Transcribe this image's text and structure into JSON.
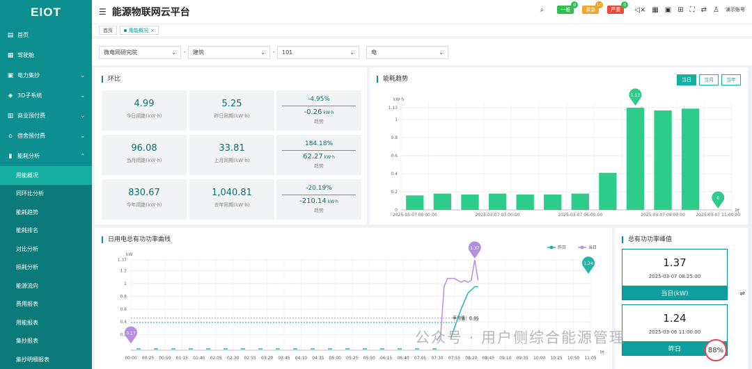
{
  "app": {
    "logo": "EIOT",
    "title": "能源物联网云平台"
  },
  "header": {
    "alarms": [
      {
        "label": "一般",
        "count": "0",
        "color": "#2fbf4f"
      },
      {
        "label": "紧急",
        "count": "10",
        "color": "#f5a623"
      },
      {
        "label": "严重",
        "count": "0",
        "color": "#e74c3c"
      }
    ],
    "account": "演示账号"
  },
  "sidebar": {
    "items": [
      {
        "label": "首页",
        "icon": "▤"
      },
      {
        "label": "驾驶舱",
        "icon": "▦"
      },
      {
        "label": "电力集抄",
        "icon": "▣",
        "chev": "⌄"
      },
      {
        "label": "3D子系统",
        "icon": "◈",
        "chev": "⌄"
      },
      {
        "label": "商业预付费",
        "icon": "▥",
        "chev": "⌄"
      },
      {
        "label": "宿舍预付费",
        "icon": "⌂",
        "chev": "⌄"
      },
      {
        "label": "能耗分析",
        "icon": "▮",
        "chev": "⌃"
      }
    ],
    "subitems": [
      "用能概况",
      "同环比分析",
      "能耗趋势",
      "能耗排名",
      "对比分析",
      "损耗分析",
      "能源流向",
      "费用报表",
      "用能报表",
      "集抄报表",
      "集抄明细报表"
    ]
  },
  "tabs": [
    "首页",
    "用能概况"
  ],
  "filters": [
    "微电网研究院",
    "建筑",
    "101",
    "电"
  ],
  "ratio": {
    "title": "环比",
    "rows": [
      {
        "value": "4.99",
        "label": "今日用能(kW·h)",
        "prev": "5.25",
        "prev_label": "昨日同期(kW·h)",
        "pct": "-4.95%",
        "diff": "-0.26",
        "unit": "kW·h",
        "trend": "趋势"
      },
      {
        "value": "96.08",
        "label": "当月用能(kW·h)",
        "prev": "33.81",
        "prev_label": "上月同期(kW·h)",
        "pct": "184.18%",
        "diff": "62.27",
        "unit": "kW·h",
        "trend": "趋势"
      },
      {
        "value": "830.67",
        "label": "今年用能(kW·h)",
        "prev": "1,040.81",
        "prev_label": "去年同期(kW·h)",
        "pct": "-20.19%",
        "diff": "-210.14",
        "unit": "kW·h",
        "trend": "趋势"
      }
    ]
  },
  "trend": {
    "title": "能耗趋势",
    "buttons": [
      "当日",
      "当月",
      "当年"
    ]
  },
  "power": {
    "title": "日用电总有功功率曲线",
    "legend": [
      "昨日",
      "当日"
    ],
    "avg_label": "平均值：0.46",
    "min_label": "平均值：0.39"
  },
  "peak": {
    "title": "总有功功率峰值",
    "cards": [
      {
        "value": "1.37",
        "time": "2025-03-07 08:25:00",
        "label": "当日(kW)"
      },
      {
        "value": "1.24",
        "time": "2025-03-06 11:00:00",
        "label": "昨日"
      }
    ]
  },
  "watermark": "公众号 · 用户侧综合能源管理",
  "percent": "88%",
  "chart_data": [
    {
      "type": "bar",
      "ylabel": "kW·h",
      "xlabel": "时",
      "ylim": [
        0,
        1.13
      ],
      "yticks": [
        "0",
        "0.2",
        "0.4",
        "0.6",
        "0.8",
        "1",
        "1.13"
      ],
      "xticks": [
        "2025-03-07 00:00:00",
        "2025-03-07 03:00:00",
        "2025-03-07 06:00:00",
        "2025-03-07 09:00:00",
        "2025-03-07 11:00:00"
      ],
      "values": [
        0.16,
        0.18,
        0.17,
        0.18,
        0.17,
        0.17,
        0.18,
        0.41,
        1.13,
        1.1,
        1.12,
        0
      ],
      "max_label": "1.13",
      "min_label": "0",
      "color": "#2ecc8a"
    },
    {
      "type": "line",
      "ylabel": "kW",
      "xlabel": "时",
      "ylim": [
        0,
        1.37
      ],
      "yticks": [
        "0.2",
        "0.4",
        "0.6",
        "0.8",
        "1",
        "1.2",
        "1.37"
      ],
      "x": [
        "00:00",
        "00:25",
        "00:50",
        "01:15",
        "01:40",
        "02:05",
        "02:30",
        "02:55",
        "03:20",
        "03:45",
        "04:10",
        "04:35",
        "05:00",
        "05:25",
        "05:50",
        "06:15",
        "06:40",
        "07:05",
        "07:30",
        "07:55",
        "08:20",
        "08:45",
        "09:10",
        "09:35",
        "10:00",
        "10:25",
        "10:50",
        "11:05"
      ],
      "series": [
        {
          "name": "昨日",
          "color": "#22b5a8",
          "max_label": "1.24"
        },
        {
          "name": "当日",
          "color": "#b48fe0",
          "max_label": "1.37",
          "min_label": "0.17"
        }
      ]
    }
  ]
}
